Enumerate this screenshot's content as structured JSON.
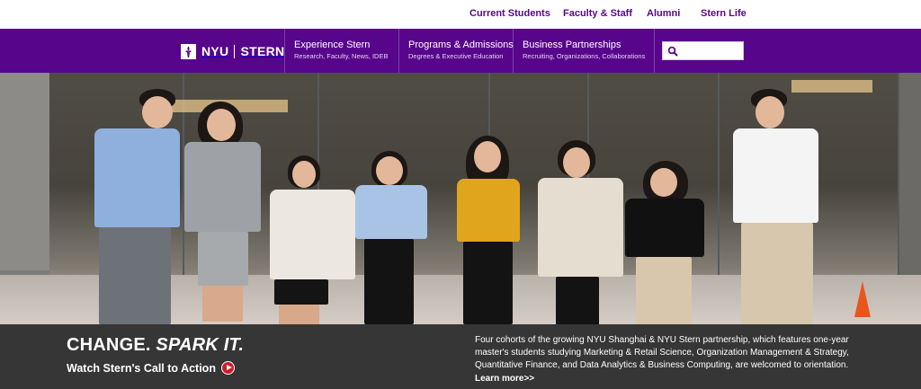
{
  "utility_nav": {
    "items": [
      {
        "label": "Current Students"
      },
      {
        "label": "Faculty & Staff"
      },
      {
        "label": "Alumni"
      },
      {
        "label": "Stern Life"
      }
    ]
  },
  "main_nav": {
    "logo": {
      "left": "NYU",
      "right": "STERN"
    },
    "items": [
      {
        "title": "Experience Stern",
        "subtitle": "Research, Faculty, News, IDEB"
      },
      {
        "title": "Programs & Admissions",
        "subtitle": "Degrees & Executive Education"
      },
      {
        "title": "Business Partnerships",
        "subtitle": "Recruiting, Organizations, Collaborations"
      }
    ],
    "search": {
      "placeholder": "",
      "value": "",
      "icon": "search-icon"
    }
  },
  "hero": {
    "image": "group-of-students-jumping-photo"
  },
  "banner": {
    "headline_main": "CHANGE.",
    "headline_emph": "SPARK IT.",
    "cta_label": "Watch Stern's Call to Action",
    "cta_icon": "play-circle-icon",
    "description": "Four cohorts of the growing NYU Shanghai & NYU Stern partnership, which features one-year master's students studying Marketing & Retail Science, Organization Management & Strategy, Quantitative Finance, and Data Analytics & Business Computing, are welcomed to orientation.",
    "learn_more": "Learn more>>"
  },
  "colors": {
    "brand_purple": "#57068c",
    "banner_dark": "#363636",
    "play_red": "#c8202b"
  }
}
